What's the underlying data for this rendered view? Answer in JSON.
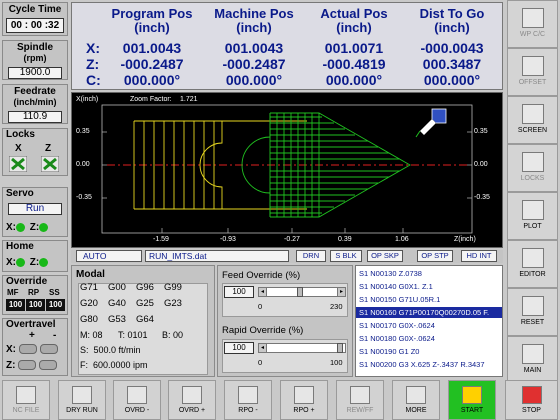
{
  "cycle_time": {
    "label": "Cycle Time",
    "value": "00 : 00 :32"
  },
  "spindle": {
    "label": "Spindle",
    "unit": "(rpm)",
    "value": "1900.0"
  },
  "feedrate": {
    "label": "Feedrate",
    "unit": "(inch/min)",
    "value": "110.9"
  },
  "locks": {
    "label": "Locks",
    "x": "X",
    "z": "Z"
  },
  "servo": {
    "label": "Servo",
    "value": "Run",
    "x": "X:",
    "z": "Z:"
  },
  "home": {
    "label": "Home",
    "x": "X:",
    "z": "Z:"
  },
  "override": {
    "label": "Override",
    "mf": "MF",
    "rp": "RP",
    "ss": "SS",
    "mf_val": "100",
    "rp_val": "100",
    "ss_val": "100"
  },
  "overtravel": {
    "label": "Overtravel",
    "plus": "+",
    "minus": "-",
    "x": "X:",
    "z": "Z:"
  },
  "positions": {
    "headers": [
      "Program Pos\n(inch)",
      "Machine Pos\n(inch)",
      "Actual Pos\n(inch)",
      "Dist To Go\n(inch)"
    ],
    "h1": [
      "Program Pos",
      "Machine Pos",
      "Actual Pos",
      "Dist To Go"
    ],
    "h2": [
      "(inch)",
      "(inch)",
      "(inch)",
      "(inch)"
    ],
    "axes": [
      "X:",
      "Z:",
      "C:"
    ],
    "rows": [
      [
        "001.0043",
        "001.0043",
        "001.0071",
        "-000.0043"
      ],
      [
        "-000.2487",
        "-000.2487",
        "-000.4819",
        "000.3487"
      ],
      [
        "000.000°",
        "000.000°",
        "000.000°",
        "000.000°"
      ]
    ]
  },
  "plot": {
    "y_axis": "X(inch)",
    "zoom_label": "Zoom Factor:",
    "zoom_value": "1.721",
    "y_ticks": [
      "0.35",
      "0.00",
      "-0.35"
    ],
    "x_ticks": [
      "-1.59",
      "-0.93",
      "-0.27",
      "0.39",
      "1.06"
    ],
    "x_axis": "Z(inch)"
  },
  "status": {
    "mode": "AUTO",
    "file": "RUN_IMTS.dat",
    "drn": "DRN",
    "sblk": "S BLK",
    "opskp": "OP SKP",
    "opstp": "OP STP",
    "hdint": "HD INT"
  },
  "modal": {
    "label": "Modal",
    "codes": [
      [
        "G71",
        "G00",
        "G96",
        "G99"
      ],
      [
        "G20",
        "G40",
        "G25",
        "G23"
      ],
      [
        "G80",
        "G53",
        "G64",
        ""
      ]
    ],
    "m": "M: 08",
    "t": "T: 0101",
    "b": "B: 00",
    "s": "S:  500.0 ft/min",
    "f": "F:  600.0000 ipm"
  },
  "feed_override": {
    "label": "Feed Override (%)",
    "value": "100",
    "min": "0",
    "max": "230"
  },
  "rapid_override": {
    "label": "Rapid Override (%)",
    "value": "100",
    "min": "0",
    "max": "100"
  },
  "program": [
    "S1 N00130 Z.0738",
    "S1 N00140 G0X1. Z.1",
    "S1 N00150 G71U.05R.1",
    "S1 N00160 G71P00170Q00270D.05 F.",
    "S1 N00170 G0X-.0624",
    "S1 N00180 G0X-.0624",
    "S1 N00190 G1 Z0",
    "S1 N00200 G3 X.625 Z-.3437 R.3437"
  ],
  "side_buttons": [
    "WP C/C",
    "OFFSET",
    "SCREEN",
    "LOCKS",
    "PLOT",
    "EDITOR",
    "RESET",
    "MAIN"
  ],
  "bottom_buttons": [
    "NC FILE",
    "DRY RUN",
    "OVRD -",
    "OVRD +",
    "RPO -",
    "RPO +",
    "REW/FF",
    "MORE",
    "START",
    "STOP"
  ],
  "colors": {
    "navy": "#0a1a8a",
    "start": "#22c022",
    "selection": "#1a2aa0"
  }
}
